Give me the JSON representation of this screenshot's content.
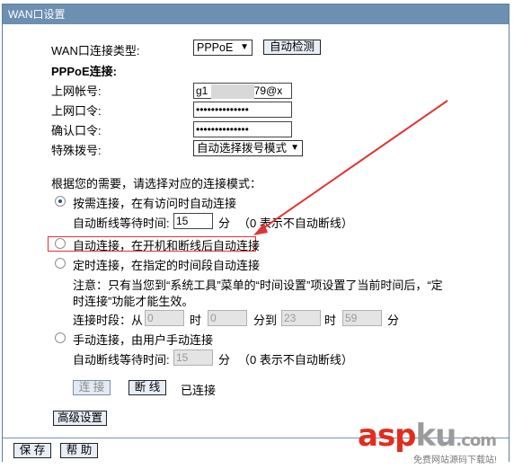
{
  "window": {
    "title": "WAN口设置"
  },
  "wan": {
    "type_label": "WAN口连接类型:",
    "type_value": "PPPoE",
    "detect_button": "自动检测"
  },
  "pppoe": {
    "section_title": "PPPoE连接:",
    "account_label": "上网帐号:",
    "account_value_start": "g1",
    "account_value_end": "579@x",
    "password_label": "上网口令:",
    "password_value": "••••••••••••••",
    "confirm_label": "确认口令:",
    "confirm_value": "••••••••••••••",
    "dial_label": "特殊拨号:",
    "dial_value": "自动选择拨号模式"
  },
  "mode": {
    "intro": "根据您的需要，请选择对应的连接模式：",
    "on_demand": "按需连接，在有访问时自动连接",
    "idle_label": "自动断线等待时间:",
    "idle_value": "15",
    "idle_unit": "分",
    "idle_note": "（0 表示不自动断线）",
    "auto": "自动连接，在开机和断线后自动连接",
    "timed": "定时连接，在指定的时间段自动连接",
    "timed_note_1": "注意：只有当您到“系统工具”菜单的“时间设置”项设置了当前时间后，“定",
    "timed_note_2": "时连接”功能才能生效。",
    "period_label": "连接时段：从",
    "from_hour": "0",
    "hour_unit": "时",
    "from_min": "0",
    "to_label": "分到",
    "to_hour": "23",
    "to_hour_unit": "时",
    "to_min": "59",
    "min_unit": "分",
    "manual": "手动连接，由用户手动连接",
    "manual_idle_label": "自动断线等待时间:",
    "manual_idle_value": "15",
    "manual_idle_unit": "分",
    "manual_idle_note": "（0 表示不自动断线）",
    "selected": "on_demand"
  },
  "actions": {
    "connect": "连 接",
    "disconnect": "断 线",
    "status": "已连接",
    "advanced": "高级设置",
    "save": "保 存",
    "help": "帮 助"
  },
  "watermark": {
    "asp": "asp",
    "ku": "ku",
    "com": ".com",
    "sub": "免费网站源码下载站!"
  },
  "colors": {
    "titlebar": "#6d8fb1",
    "highlight": "#e03434",
    "arrow": "#e03434"
  }
}
